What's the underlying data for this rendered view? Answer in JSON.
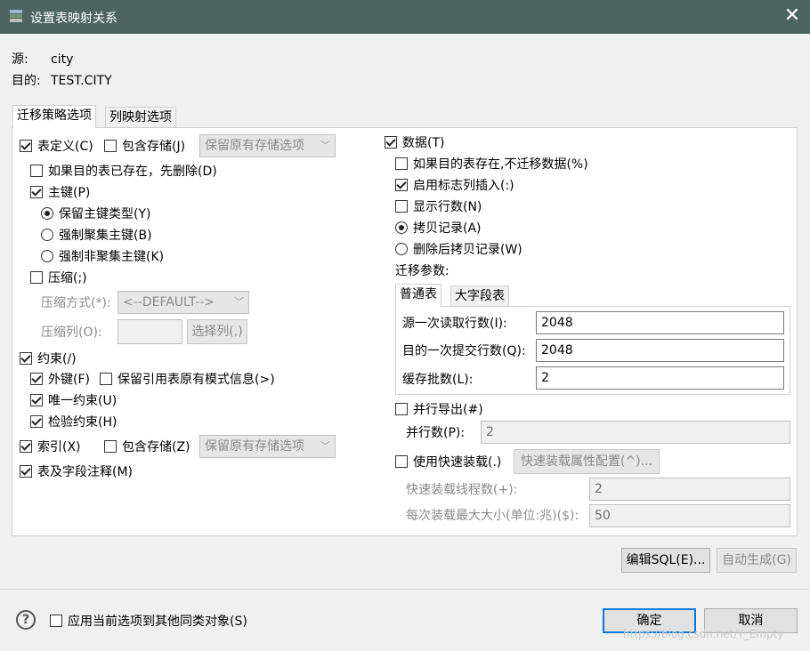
{
  "window": {
    "title": "设置表映射关系",
    "close_glyph": "✕"
  },
  "header": {
    "source_label": "源:",
    "source_value": "city",
    "target_label": "目的:",
    "target_value": "TEST.CITY"
  },
  "tabs": [
    {
      "label": "迁移策略选项",
      "active": true
    },
    {
      "label": "列映射选项",
      "active": false
    }
  ],
  "left": {
    "table_def": {
      "label": "表定义(C)",
      "checked": true
    },
    "include_storage_1": {
      "label": "包含存储(J)",
      "checked": false
    },
    "storage_combo_1": "保留原有存储选项",
    "drop_if_exists": {
      "label": "如果目的表已存在，先删除(D)",
      "checked": false
    },
    "primary_key": {
      "label": "主键(P)",
      "checked": true
    },
    "keep_pk_type": {
      "label": "保留主键类型(Y)",
      "checked": true
    },
    "force_clustered": {
      "label": "强制聚集主键(B)",
      "checked": false
    },
    "force_nonclustered": {
      "label": "强制非聚集主键(K)",
      "checked": false
    },
    "compress": {
      "label": "压缩(;)",
      "checked": false
    },
    "compress_method_label": "压缩方式(*):",
    "compress_method_value": "<--DEFAULT-->",
    "compress_cols_label": "压缩列(O):",
    "compress_cols_value": "",
    "select_cols_button": "选择列(,)",
    "constraints": {
      "label": "约束(/)",
      "checked": true
    },
    "foreign_key": {
      "label": "外键(F)",
      "checked": true
    },
    "keep_ref_schema": {
      "label": "保留引用表原有模式信息(>)",
      "checked": false
    },
    "unique": {
      "label": "唯一约束(U)",
      "checked": true
    },
    "check": {
      "label": "检验约束(H)",
      "checked": true
    },
    "index": {
      "label": "索引(X)",
      "checked": true
    },
    "include_storage_2": {
      "label": "包含存储(Z)",
      "checked": false
    },
    "storage_combo_2": "保留原有存储选项",
    "comments": {
      "label": "表及字段注释(M)",
      "checked": true
    }
  },
  "right": {
    "data": {
      "label": "数据(T)",
      "checked": true
    },
    "skip_if_exists": {
      "label": "如果目的表存在,不迁移数据(%)",
      "checked": false
    },
    "identity_insert": {
      "label": "启用标志列插入(:)",
      "checked": true
    },
    "show_rows": {
      "label": "显示行数(N)",
      "checked": false
    },
    "copy_records": {
      "label": "拷贝记录(A)",
      "checked": true
    },
    "delete_then_copy": {
      "label": "删除后拷贝记录(W)",
      "checked": false
    },
    "params_label": "迁移参数:",
    "sub_tabs": [
      {
        "label": "普通表",
        "active": true
      },
      {
        "label": "大字段表",
        "active": false
      }
    ],
    "read_rows_label": "源一次读取行数(I):",
    "read_rows_value": "2048",
    "commit_rows_label": "目的一次提交行数(Q):",
    "commit_rows_value": "2048",
    "buffer_label": "缓存批数(L):",
    "buffer_value": "2",
    "parallel_export": {
      "label": "并行导出(#)",
      "checked": false
    },
    "parallel_label": "并行数(P):",
    "parallel_value": "2",
    "fast_load": {
      "label": "使用快速装载(.)",
      "checked": false
    },
    "fast_load_config_button": "快速装载属性配置(^)...",
    "fast_threads_label": "快速装载线程数(+):",
    "fast_threads_value": "2",
    "fast_max_label": "每次装载最大大小(单位:兆)($):",
    "fast_max_value": "50"
  },
  "actions": {
    "edit_sql": "编辑SQL(E)...",
    "auto_gen": "自动生成(G)"
  },
  "footer": {
    "help_glyph": "?",
    "apply_all": {
      "label": "应用当前选项到其他同类对象(S)",
      "checked": false
    },
    "ok": "确定",
    "cancel": "取消",
    "watermark": "https://blog.csdn.net/Y_Empty"
  }
}
